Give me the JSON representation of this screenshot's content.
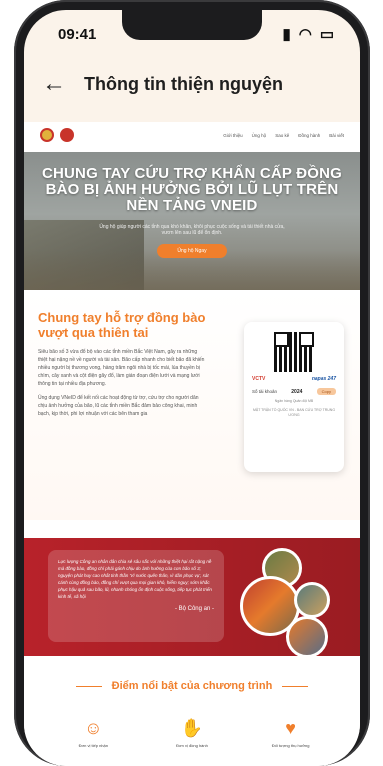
{
  "status": {
    "time": "09:41"
  },
  "header": {
    "back_icon": "arrow-left-icon",
    "title": "Thông tin thiện nguyện"
  },
  "nav": {
    "links": [
      "Giới thiệu",
      "Ủng hộ",
      "Sao kê",
      "Đồng hành",
      "Bài viết"
    ]
  },
  "hero": {
    "title": "CHUNG TAY CỨU TRỢ KHẨN CẤP ĐỒNG BÀO BỊ ẢNH HƯỞNG BỞI LŨ LỤT TRÊN NỀN TẢNG VNEID",
    "subtitle": "Ủng hộ giúp người các tỉnh qua khó khăn, khôi phục cuộc sống và tái thiết nhà cửa, vươn lên sau lũ để ổn định.",
    "button": "Ủng hộ Ngay"
  },
  "section": {
    "title": "Chung tay hỗ trợ đồng bào vượt qua thiên tai",
    "para1": "Siêu bão số 3 vừa đổ bộ vào các tỉnh miền Bắc Việt Nam, gây ra những thiệt hại nặng nề về người và tài sản. Bão cấp nhanh cho biết bão đã khiến nhiều người bị thương vong, hàng trăm ngôi nhà bị tốc mái, lúa thuyền bị chìm, cây xanh và cột điện gãy đổ, làm gián đoạn điện lưới và mạng lưới thông tin tại nhiều địa phương.",
    "para2": "Ủng dụng VNeID để kết nối các hoạt động từ trợ, cứu trợ cho người dân chịu ảnh hưởng của bão, lũ các tỉnh miền Bắc đảm bảo công khai, minh bạch, kịp thời, phi lợi nhuận với các bên tham gia"
  },
  "qr_card": {
    "logo_left": "VCTV",
    "logo_right": "napas 247",
    "account_label": "Số tài khoản",
    "account_value": "2024",
    "copy_button": "Copy",
    "bank_name": "Ngân hàng Quân đội MB",
    "note": "MẶT TRẬN TỔ QUỐC VN - BAN CỨU TRỢ TRUNG ƯƠNG"
  },
  "quote": {
    "text": "Lực lượng Công an nhân dân chia sẻ sâu sắc với những thiệt hại rất nặng nề mà đồng bào, đồng chí phải gánh chịu do ảnh hưởng của cơn bão số 3; nguyện phát huy cao nhất tinh thần 'Vì nước quên thân, vì dân phục vụ', sát cánh cùng đồng bào, đồng chí vượt qua mọi gian khó, hiểm nguy; sớm khắc phục hậu quả sau bão, lũ, nhanh chóng ổn định cuộc sống, tiếp tục phát triển kinh tế, xã hội",
    "author": "- Bộ Công an -"
  },
  "highlights": {
    "title": "Điểm nổi bật của chương trình",
    "items": [
      {
        "icon": "people-icon",
        "label": "Đơn vị tiếp nhận"
      },
      {
        "icon": "hands-icon",
        "label": "Đơn vị đồng hành"
      },
      {
        "icon": "heart-hand-icon",
        "label": "Đối tượng thụ hưởng"
      }
    ]
  }
}
